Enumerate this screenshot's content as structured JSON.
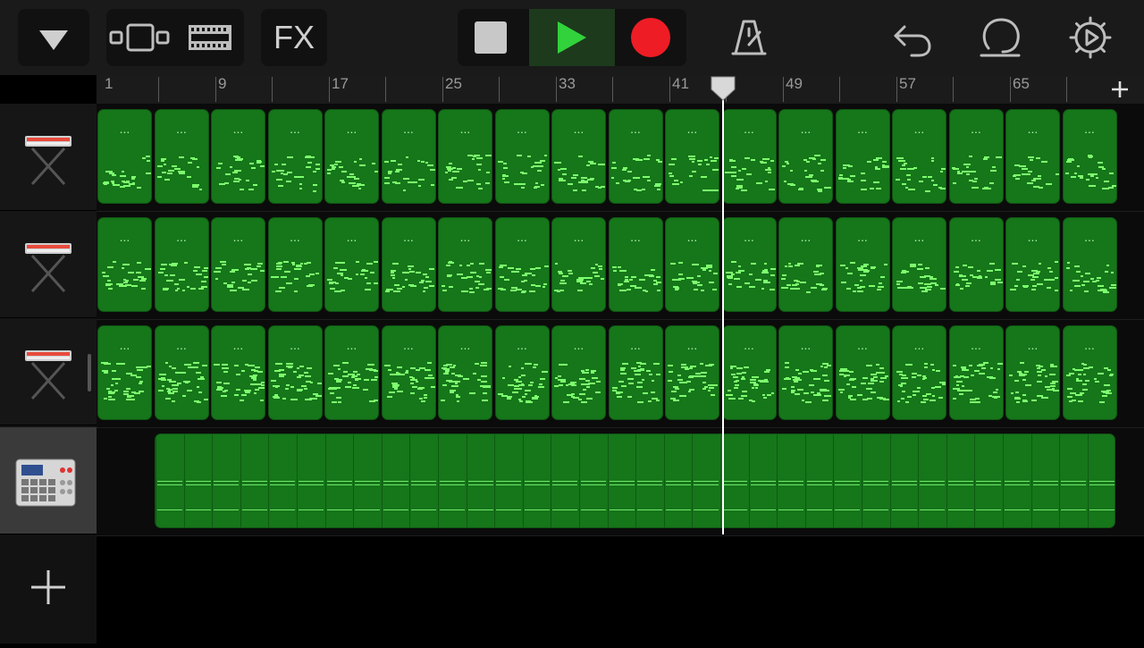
{
  "toolbar": {
    "browser_icon": "triangle-down-icon",
    "tracks_view_icon": "tracks-view-icon",
    "loop_browser_icon": "loop-browser-icon",
    "fx_label": "FX",
    "stop_icon": "stop-icon",
    "play_icon": "play-icon",
    "record_icon": "record-icon",
    "metronome_icon": "metronome-icon",
    "undo_icon": "undo-icon",
    "loop_icon": "loop-icon",
    "settings_icon": "gear-icon"
  },
  "colors": {
    "region_green": "#16761a",
    "note_green": "#7dff6e",
    "play_green": "#32d23c",
    "record_red": "#ee1c25"
  },
  "ruler": {
    "bar_numbers": [
      "1",
      "9",
      "17",
      "25",
      "33",
      "41",
      "49",
      "57",
      "65"
    ],
    "playhead_bar": 45
  },
  "tracks": [
    {
      "instrument": "keyboard-icon",
      "selected": false,
      "region_label": "..."
    },
    {
      "instrument": "keyboard-icon",
      "selected": false,
      "region_label": "..."
    },
    {
      "instrument": "keyboard-icon",
      "selected": false,
      "region_label": "..."
    },
    {
      "instrument": "drum-machine-icon",
      "selected": true,
      "region_label": ""
    }
  ],
  "add_track_icon": "plus-icon",
  "add_section_icon": "plus-icon"
}
